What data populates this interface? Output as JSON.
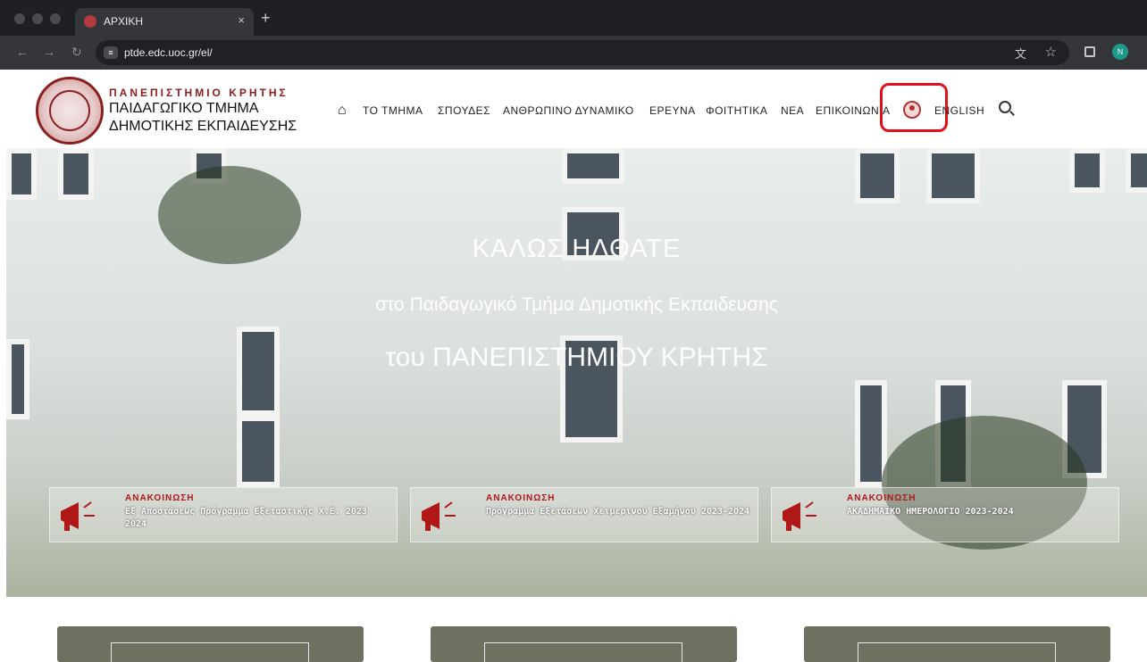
{
  "browser": {
    "tab_title": "ΑΡΧΙΚΗ",
    "tab_close": "×",
    "new_tab": "+",
    "url": "ptde.edc.uoc.gr/el/",
    "profile_initial": "N"
  },
  "header": {
    "university": "ΠΑΝΕΠΙΣΤΗΜΙΟ ΚΡΗΤΗΣ",
    "department_line1": "ΠΑΙΔΑΓΩΓΙΚΟ ΤΜΗΜΑ",
    "department_line2": "ΔΗΜΟΤΙΚΗΣ ΕΚΠΑΙΔΕΥΣΗΣ",
    "nav": [
      "ΤΟ ΤΜΗΜΑ",
      "ΣΠΟΥΔΕΣ",
      "ΑΝΘΡΩΠΙΝΟ ΔΥΝΑΜΙΚΟ",
      "ΕΡΕΥΝΑ",
      "ΦΟΙΤΗΤΙΚΑ",
      "ΝΕΑ",
      "ΕΠΙΚΟΙΝΩΝΙΑ"
    ],
    "language": "ENGLISH"
  },
  "hero": {
    "title": "ΚΑΛΩΣ ΗΛΘΑΤΕ",
    "subtitle": "στο Παιδαγωγικό Τμήμα Δημοτικής Εκπαιδευσης",
    "subtitle2": "του ΠΑΝΕΠΙΣΤΗΜΙΟΥ ΚΡΗΤΗΣ"
  },
  "announcements": [
    {
      "kind": "ΑΝΑΚΟΙΝΩΣΗ",
      "text": "Εξ Αποστάσεως Πρόγραμμα Εξεταστικής Χ.Ε. 2023 2024"
    },
    {
      "kind": "ΑΝΑΚΟΙΝΩΣΗ",
      "text": "Πρόγραμμα Εξετάσεων Χειμερινού Εξαμήνου 2023-2024"
    },
    {
      "kind": "ΑΝΑΚΟΙΝΩΣΗ",
      "text": "ΑΚΑΔΗΜΑΪΚΟ ΗΜΕΡΟΛΟΓΙΟ 2023-2024"
    }
  ],
  "colors": {
    "brand": "#8b2020",
    "highlight": "#e0101a"
  },
  "icons": [
    "home-icon",
    "account-icon",
    "search-icon",
    "megaphone-icon"
  ]
}
